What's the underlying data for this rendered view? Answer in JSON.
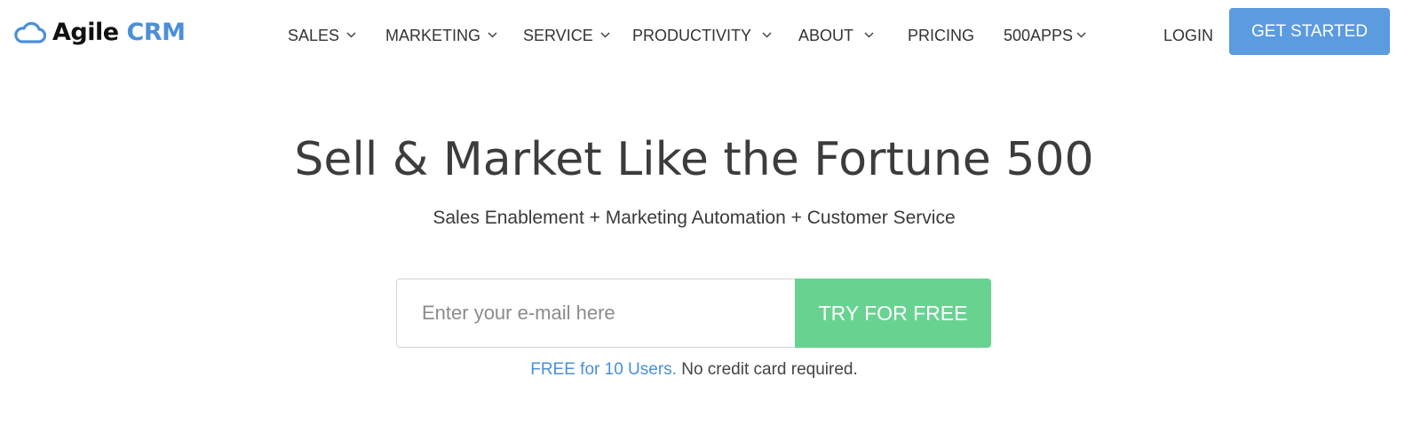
{
  "colors": {
    "brand_blue": "#4b8fd8",
    "cta_blue": "#5b9be0",
    "cta_green": "#68d391",
    "text_dark": "#3c3c3c"
  },
  "header": {
    "logo": {
      "icon": "cloud-icon",
      "word1": "Agile",
      "word2": "CRM"
    },
    "nav": [
      {
        "label": "SALES",
        "has_dropdown": true
      },
      {
        "label": "MARKETING",
        "has_dropdown": true
      },
      {
        "label": "SERVICE",
        "has_dropdown": true
      },
      {
        "label": "PRODUCTIVITY",
        "has_dropdown": true
      },
      {
        "label": "ABOUT",
        "has_dropdown": true
      },
      {
        "label": "PRICING",
        "has_dropdown": false
      },
      {
        "label": "500APPS",
        "has_dropdown": true
      }
    ],
    "login_label": "LOGIN",
    "get_started_label": "GET STARTED"
  },
  "hero": {
    "title": "Sell & Market Like the Fortune 500",
    "subtitle": "Sales Enablement + Marketing Automation + Customer Service",
    "email_placeholder": "Enter your e-mail here",
    "email_value": "",
    "try_label": "TRY FOR FREE",
    "note_link": "FREE for 10 Users.",
    "note_text": " No credit card required."
  }
}
